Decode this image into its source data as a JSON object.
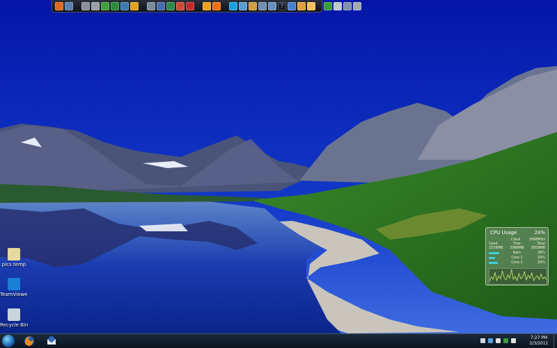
{
  "desktop": {
    "icons": [
      {
        "label": "pics temp",
        "icon": "folder-icon",
        "color": "#e8d9a0"
      },
      {
        "label": "TeamViewe...",
        "icon": "teamviewer-icon",
        "color": "#1a7fd6"
      },
      {
        "label": "Recycle Bin",
        "icon": "recycle-bin-icon",
        "color": "#c8d4de"
      }
    ]
  },
  "dock": {
    "icons": [
      "firefox-icon",
      "mail-icon",
      "",
      "drive-icon",
      "disk-icon",
      "utorrent-icon",
      "wordpress-icon",
      "vlc-icon",
      "grid-app-icon",
      "",
      "window-icon",
      "excel-icon",
      "photo-icon",
      "media-icon",
      "flash-icon",
      "",
      "orange-app-icon",
      "skype-icon",
      "",
      "monitor-icon",
      "folder-icon",
      "document-icon",
      "screen-icon",
      "user-icon",
      "help-icon",
      "archive-icon",
      "picture-icon",
      "green-app-icon",
      "",
      "ftp-icon",
      "network-icon",
      "drive-icon",
      "tools-icon"
    ],
    "help_glyph": "?"
  },
  "cpu_gadget": {
    "title": "CPU Usage",
    "percent": "24%",
    "rows": [
      {
        "left": "",
        "mid": "Clock",
        "right": "3998MHz"
      },
      {
        "left": "Used",
        "mid": "Free",
        "right": "Total"
      },
      {
        "left": "2316MB",
        "mid": "3988MB",
        "right": "3859MB"
      },
      {
        "left": "",
        "mid": "Ram",
        "right": "38%"
      },
      {
        "left": "",
        "mid": "Core 1",
        "right": "18%"
      },
      {
        "left": "",
        "mid": "Core 2",
        "right": "29%"
      }
    ],
    "ram_fraction": 0.38,
    "core1_fraction": 0.18,
    "core2_fraction": 0.29,
    "graph": [
      5,
      12,
      8,
      20,
      6,
      14,
      9,
      22,
      11,
      7,
      16,
      10,
      25,
      8,
      13,
      6,
      18,
      9,
      12,
      21,
      7,
      15,
      10,
      19,
      6,
      11,
      14,
      8,
      17,
      9,
      12,
      7
    ]
  },
  "taskbar": {
    "clock_time": "7:27 PM",
    "clock_date": "2/3/2011",
    "pinned": [
      "firefox-icon",
      "thunderbird-icon"
    ],
    "tray": [
      "arrow-up-icon",
      "network-icon",
      "flag-icon",
      "shield-icon",
      "speaker-icon"
    ]
  }
}
